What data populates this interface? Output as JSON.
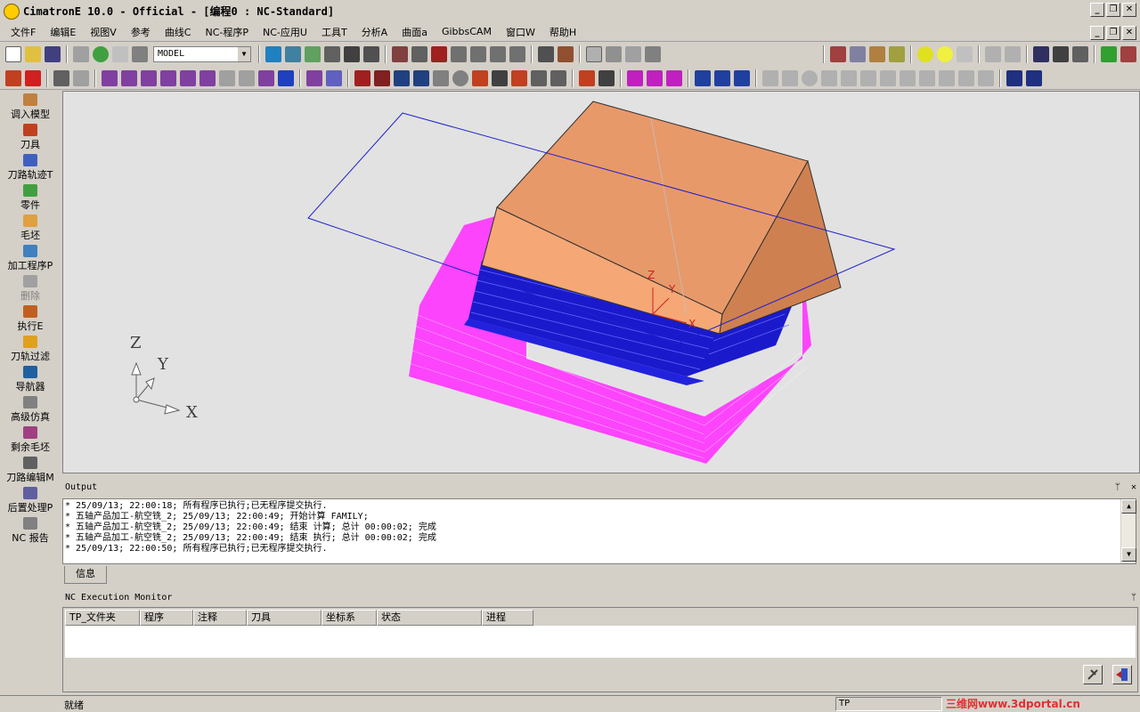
{
  "window": {
    "title": "CimatronE 10.0 - Official - [编程0 : NC-Standard]"
  },
  "menu": [
    "文件F",
    "编辑E",
    "视图V",
    "参考",
    "曲线C",
    "NC-程序P",
    "NC-应用U",
    "工具T",
    "分析A",
    "曲面a",
    "GibbsCAM",
    "窗口W",
    "帮助H"
  ],
  "toolbar": {
    "model_select": "MODEL"
  },
  "left_panel": {
    "items": [
      {
        "label": "调入模型",
        "color": "#c08040",
        "disabled": false
      },
      {
        "label": "刀具",
        "color": "#c04020",
        "disabled": false
      },
      {
        "label": "刀路轨迹T",
        "color": "#4060c0",
        "disabled": false
      },
      {
        "label": "零件",
        "color": "#40a040",
        "disabled": false
      },
      {
        "label": "毛坯",
        "color": "#e0a040",
        "disabled": false
      },
      {
        "label": "加工程序P",
        "color": "#4080c0",
        "disabled": false
      },
      {
        "label": "删除",
        "color": "#a0a0a0",
        "disabled": true
      },
      {
        "label": "执行E",
        "color": "#c06020",
        "disabled": false
      },
      {
        "label": "刀轨过滤",
        "color": "#e0a020",
        "disabled": false
      },
      {
        "label": "导航器",
        "color": "#2060a0",
        "disabled": false
      },
      {
        "label": "高级仿真",
        "color": "#808080",
        "disabled": false
      },
      {
        "label": "剩余毛坯",
        "color": "#a04080",
        "disabled": false
      },
      {
        "label": "刀路编辑M",
        "color": "#606060",
        "disabled": false
      },
      {
        "label": "后置处理P",
        "color": "#6060a0",
        "disabled": false
      },
      {
        "label": "NC 报告",
        "color": "#808080",
        "disabled": false
      }
    ]
  },
  "viewport": {
    "axis_z": "Z",
    "axis_y": "Y",
    "axis_x": "X",
    "model_axis_z": "Z",
    "model_axis_y": "Y",
    "model_axis_x": "X",
    "colors": {
      "part": "#f5a876",
      "toolpath_blue": "#1a1acc",
      "toolpath_magenta": "#ff22ff",
      "bg": "#e2e2e2"
    }
  },
  "output": {
    "title": "Output",
    "lines": [
      "* 25/09/13; 22:00:18; 所有程序已执行;已无程序提交执行.",
      "* 五轴产品加工-航空铣_2; 25/09/13; 22:00:49; 开始计算 FAMILY;",
      "* 五轴产品加工-航空铣_2; 25/09/13; 22:00:49; 结束 计算; 总计 00:00:02; 完成",
      "* 五轴产品加工-航空铣_2; 25/09/13; 22:00:49; 结束 执行; 总计 00:00:02; 完成",
      "* 25/09/13; 22:00:50; 所有程序已执行;已无程序提交执行."
    ],
    "tab": "信息"
  },
  "monitor": {
    "title": "NC Execution Monitor",
    "columns": [
      "TP_文件夹",
      "程序",
      "注释",
      "刀具",
      "坐标系",
      "状态",
      "进程"
    ]
  },
  "status": {
    "left": "就绪",
    "tp": "TP",
    "watermark": "三维网www.3dportal.cn"
  }
}
